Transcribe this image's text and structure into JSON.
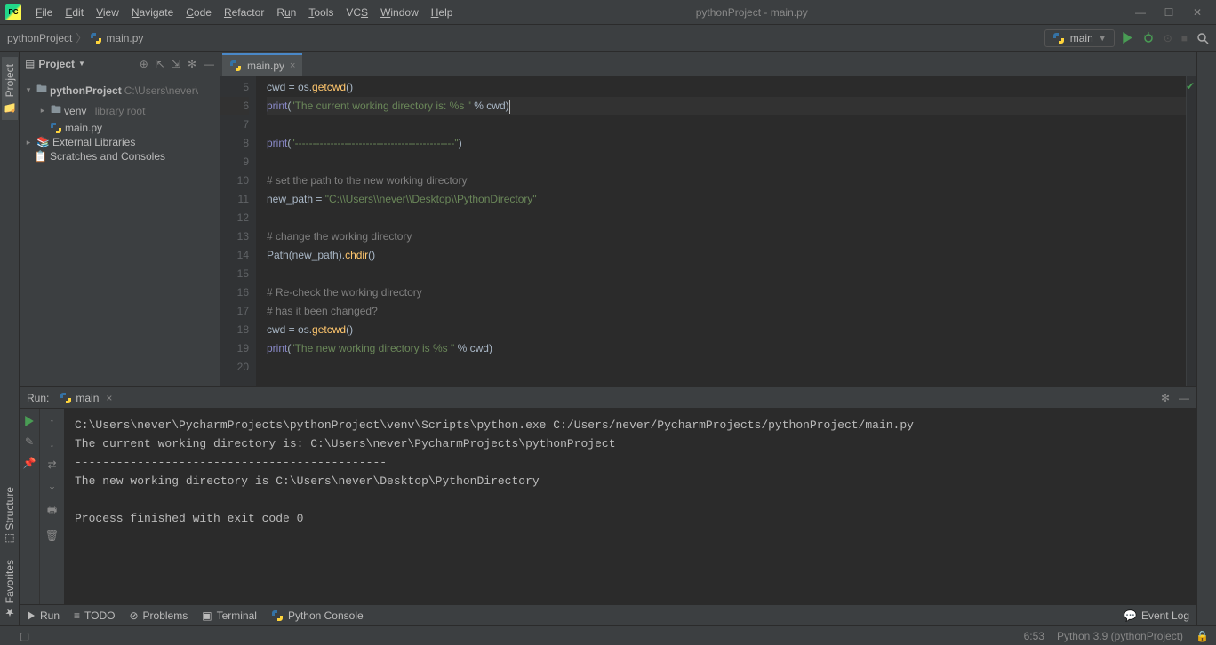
{
  "window": {
    "title": "pythonProject - main.py"
  },
  "menu": [
    "File",
    "Edit",
    "View",
    "Navigate",
    "Code",
    "Refactor",
    "Run",
    "Tools",
    "VCS",
    "Window",
    "Help"
  ],
  "breadcrumb": {
    "project": "pythonProject",
    "file": "main.py"
  },
  "run_config": {
    "name": "main"
  },
  "project_panel": {
    "title": "Project",
    "root": "pythonProject",
    "root_path": "C:\\Users\\never\\",
    "venv": "venv",
    "venv_note": "library root",
    "file": "main.py",
    "ext_libs": "External Libraries",
    "scratches": "Scratches and Consoles"
  },
  "editor": {
    "tab": "main.py",
    "first_line_no": 5,
    "lines": [
      {
        "n": 5,
        "raw": "cwd = os.getcwd()"
      },
      {
        "n": 6,
        "raw": "print(\"The current working directory is: %s \" % cwd)",
        "hl": true
      },
      {
        "n": 7,
        "raw": ""
      },
      {
        "n": 8,
        "raw": "print(\"---------------------------------------------\")"
      },
      {
        "n": 9,
        "raw": ""
      },
      {
        "n": 10,
        "raw": "# set the path to the new working directory"
      },
      {
        "n": 11,
        "raw": "new_path = \"C:\\\\Users\\\\never\\\\Desktop\\\\PythonDirectory\""
      },
      {
        "n": 12,
        "raw": ""
      },
      {
        "n": 13,
        "raw": "# change the working directory"
      },
      {
        "n": 14,
        "raw": "Path(new_path).chdir()"
      },
      {
        "n": 15,
        "raw": ""
      },
      {
        "n": 16,
        "raw": "# Re-check the working directory"
      },
      {
        "n": 17,
        "raw": "# has it been changed?"
      },
      {
        "n": 18,
        "raw": "cwd = os.getcwd()"
      },
      {
        "n": 19,
        "raw": "print(\"The new working directory is %s \" % cwd)"
      },
      {
        "n": 20,
        "raw": ""
      }
    ]
  },
  "run_panel": {
    "label": "Run:",
    "tab": "main",
    "output": "C:\\Users\\never\\PycharmProjects\\pythonProject\\venv\\Scripts\\python.exe C:/Users/never/PycharmProjects/pythonProject/main.py\nThe current working directory is: C:\\Users\\never\\PycharmProjects\\pythonProject \n---------------------------------------------\nThe new working directory is C:\\Users\\never\\Desktop\\PythonDirectory \n\nProcess finished with exit code 0"
  },
  "bottom_tools": {
    "run": "Run",
    "todo": "TODO",
    "problems": "Problems",
    "terminal": "Terminal",
    "pyconsole": "Python Console",
    "eventlog": "Event Log"
  },
  "status": {
    "pos": "6:53",
    "interpreter": "Python 3.9 (pythonProject)"
  },
  "side_tabs": {
    "project": "Project",
    "structure": "Structure",
    "favorites": "Favorites"
  }
}
